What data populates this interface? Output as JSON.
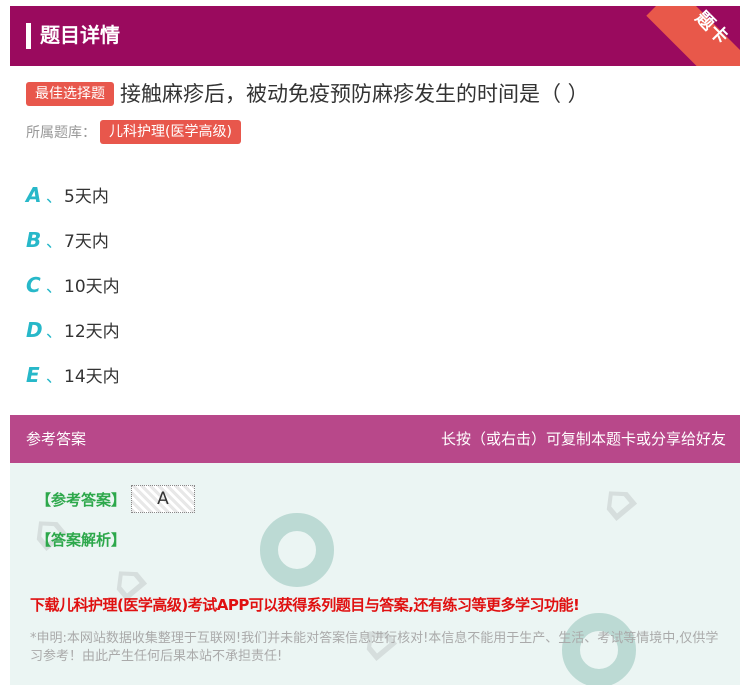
{
  "header": {
    "title": "题目详情",
    "ribbon": "题卡",
    "color": "#9a0a5e",
    "ribbon_color": "#e8584a"
  },
  "question": {
    "type_tag": "最佳选择题",
    "text": "接触麻疹后，被动免疫预防麻疹发生的时间是（ ）",
    "bank_label": "所属题库：",
    "bank_name": "儿科护理(医学高级)"
  },
  "options": [
    {
      "letter": "A",
      "sep": "、",
      "text": "5天内"
    },
    {
      "letter": "B",
      "sep": "、",
      "text": "7天内"
    },
    {
      "letter": "C",
      "sep": "、",
      "text": "10天内"
    },
    {
      "letter": "D",
      "sep": "、",
      "text": "12天内"
    },
    {
      "letter": "E",
      "sep": "、",
      "text": "14天内"
    }
  ],
  "answer_section": {
    "header_left": "参考答案",
    "header_right": "长按（或右击）可复制本题卡或分享给好友",
    "answer_label": "【参考答案】",
    "answer_value": "A",
    "explanation_label": "【答案解析】",
    "promo": "下载儿科护理(医学高级)考试APP可以获得系列题目与答案,还有练习等更多学习功能!",
    "disclaimer": "*申明:本网站数据收集整理于互联网!我们并未能对答案信息进行核对!本信息不能用于生产、生活、考试等情境中,仅供学习参考！由此产生任何后果本站不承担责任!"
  },
  "colors": {
    "accent": "#27b8c9",
    "tag": "#e8574c",
    "answer_header": "#b8488a",
    "answer_bg": "#ebf5f3",
    "green_label": "#2da84b",
    "promo_red": "#e01010"
  }
}
